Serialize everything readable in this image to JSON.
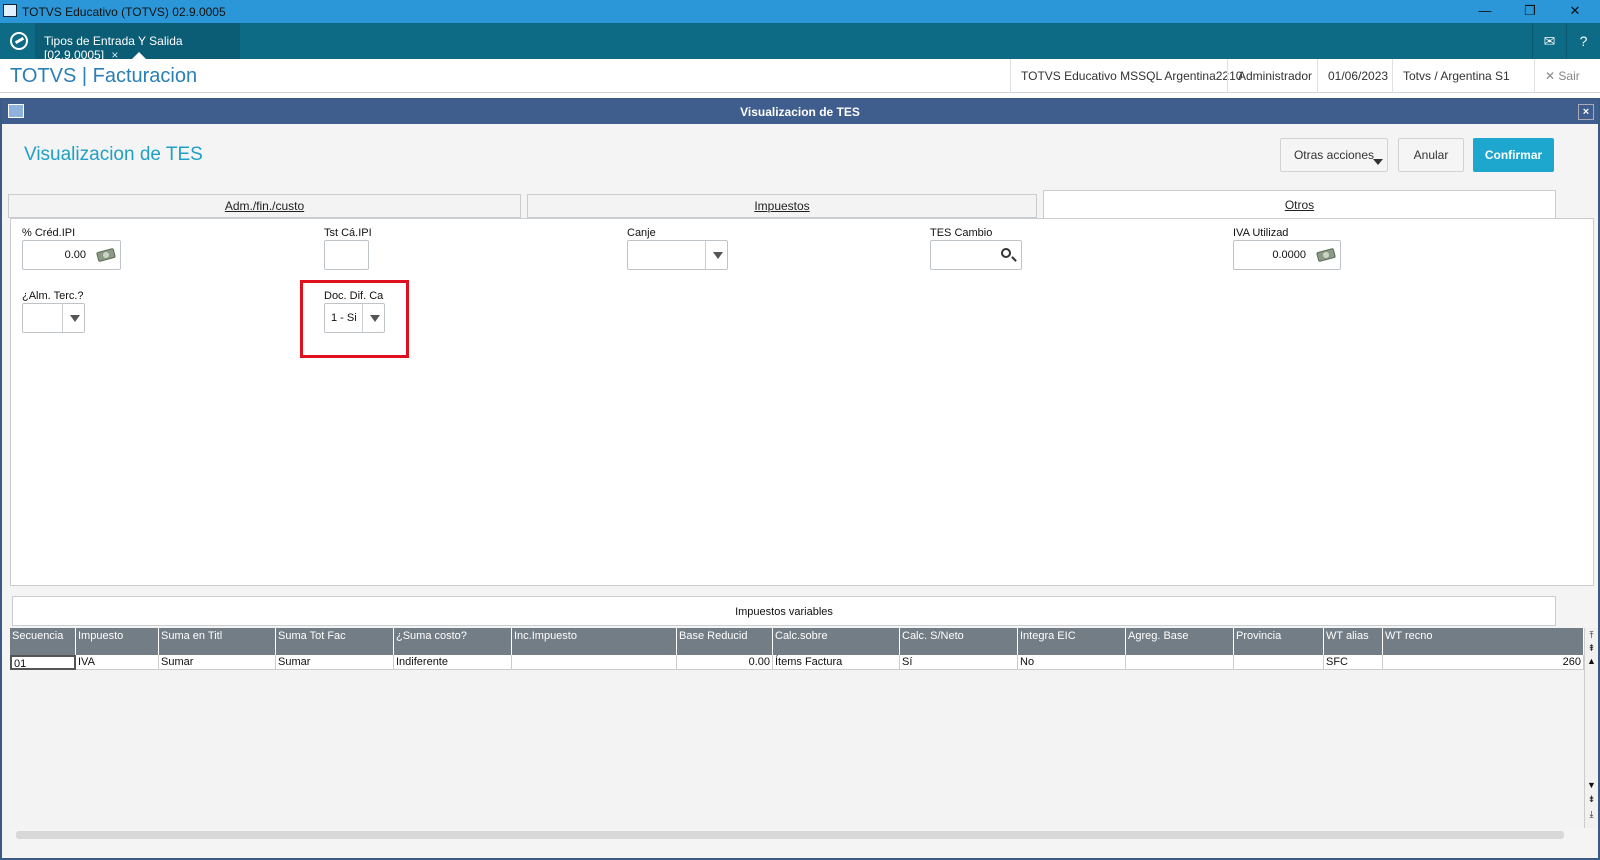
{
  "window": {
    "title": "TOTVS Educativo (TOTVS) 02.9.0005",
    "minimize": "—",
    "restore": "❐",
    "close": "✕"
  },
  "tabbar": {
    "tab_label": "Tipos de Entrada Y Salida [02.9.0005]",
    "tab_close": "×",
    "mail_icon": "✉",
    "help_icon": "?"
  },
  "header": {
    "brand": "TOTVS | Facturacion",
    "environment": "TOTVS Educativo MSSQL Argentina2210",
    "user": "Administrador",
    "date": "01/06/2023",
    "branch": "Totvs / Argentina S1",
    "exit_label": "✕  Sair"
  },
  "dialog": {
    "title": "Visualizacion de TES",
    "close": "×",
    "page_title": "Visualizacion de TES",
    "buttons": {
      "other_actions": "Otras acciones",
      "cancel": "Anular",
      "confirm": "Confirmar"
    },
    "tabs": [
      {
        "label": "Adm./fin./custo",
        "active": false
      },
      {
        "label": "Impuestos",
        "active": false
      },
      {
        "label": "Otros",
        "active": true
      }
    ]
  },
  "form": {
    "cred_ipi": {
      "label": "% Créd.IPI",
      "value": "0.00"
    },
    "tst_ca_ipi": {
      "label": "Tst Cá.IPI",
      "value": ""
    },
    "canje": {
      "label": "Canje",
      "value": ""
    },
    "tes_cambio": {
      "label": "TES Cambio",
      "value": ""
    },
    "iva_utilizad": {
      "label": "IVA Utilizad",
      "value": "0.0000"
    },
    "alm_terc": {
      "label": "¿Alm. Terc.?",
      "value": ""
    },
    "doc_dif_ca": {
      "label": "Doc. Dif. Ca",
      "value": "1 - Si"
    }
  },
  "grid": {
    "title": "Impuestos variables",
    "columns": [
      "Secuencia",
      "Impuesto",
      "Suma en Titl",
      "Suma Tot Fac",
      "¿Suma costo?",
      "Inc.Impuesto",
      "Base Reducid",
      "Calc.sobre",
      "Calc. S/Neto",
      "Integra EIC",
      "Agreg. Base",
      "Provincia",
      "WT alias",
      "WT recno"
    ],
    "rows": [
      [
        "01",
        "IVA",
        "Sumar",
        "Sumar",
        "Indiferente",
        "",
        "0.00",
        "Ítems Factura",
        "Sí",
        "No",
        "",
        "",
        "SFC",
        "260"
      ]
    ]
  },
  "colors": {
    "titlebar": "#2b97d8",
    "tabbar": "#0d6b86",
    "dialog_title": "#3f5d8d",
    "accent": "#1da7cf",
    "grid_header": "#737d86",
    "highlight": "#e0101e"
  }
}
